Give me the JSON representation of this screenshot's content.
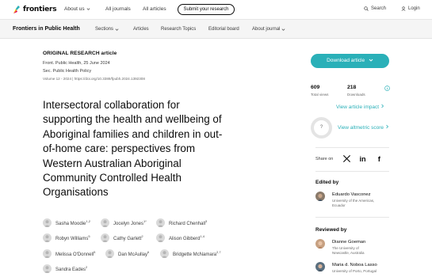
{
  "brand": {
    "logo_text": "frontiers",
    "accent": "#2ab0b8"
  },
  "topnav": {
    "about_us": "About us",
    "all_journals": "All journals",
    "all_articles": "All articles",
    "submit": "Submit your research",
    "search": "Search",
    "login": "Login"
  },
  "journalbar": {
    "name": "Frontiers in Public Health",
    "items": [
      "Sections",
      "Articles",
      "Research Topics",
      "Editorial board",
      "About journal"
    ]
  },
  "article": {
    "type": "ORIGINAL RESEARCH article",
    "journal_date": "Front. Public Health, 25 June 2024",
    "section": "Sec. Public Health Policy",
    "volume_doi": "Volume 12 - 2024 | https://doi.org/10.3389/fpubh.2024.1392308",
    "title_lines": [
      "Intersectoral collaboration for",
      "supporting the health and wellbeing of",
      "Aboriginal families and children in out-",
      "of-home care: perspectives from",
      "Western Australian Aboriginal",
      "Community Controlled Health",
      "Organisations"
    ],
    "authors": [
      {
        "name": "Sasha Moodie",
        "sup": "1,2"
      },
      {
        "name": "Jocelyn Jones",
        "sup": "1*"
      },
      {
        "name": "Richard Chenhall",
        "sup": "3"
      },
      {
        "name": "Robyn Williams",
        "sup": "5"
      },
      {
        "name": "Cathy Garlett",
        "sup": "2"
      },
      {
        "name": "Alison Gibberd",
        "sup": "1,4"
      },
      {
        "name": "Melissa O'Donnell",
        "sup": "5"
      },
      {
        "name": "Dan McAullay",
        "sup": "6"
      },
      {
        "name": "Bridgette McNamara",
        "sup": "2,7"
      },
      {
        "name": "Sandra Eades",
        "sup": "2"
      }
    ]
  },
  "sidebar": {
    "download": "Download article",
    "views_num": "609",
    "views_lbl": "Total views",
    "downloads_num": "218",
    "downloads_lbl": "Downloads",
    "impact_link": "View article impact",
    "altmetric_badge": "?",
    "altmetric_link": "View altmetric score",
    "share_on": "Share on",
    "edited_by": "Edited by",
    "editor": {
      "name": "Eduardo Vasconez",
      "aff": [
        "University of the Americas,",
        "Ecuador"
      ]
    },
    "reviewed_by": "Reviewed by",
    "reviewers": [
      {
        "name": "Dianne Goeman",
        "aff": [
          "The University of",
          "Newcastle, Australia"
        ]
      },
      {
        "name": "Maria d. Noboa Lasso",
        "aff": [
          "University of Porto, Portugal"
        ]
      }
    ]
  }
}
